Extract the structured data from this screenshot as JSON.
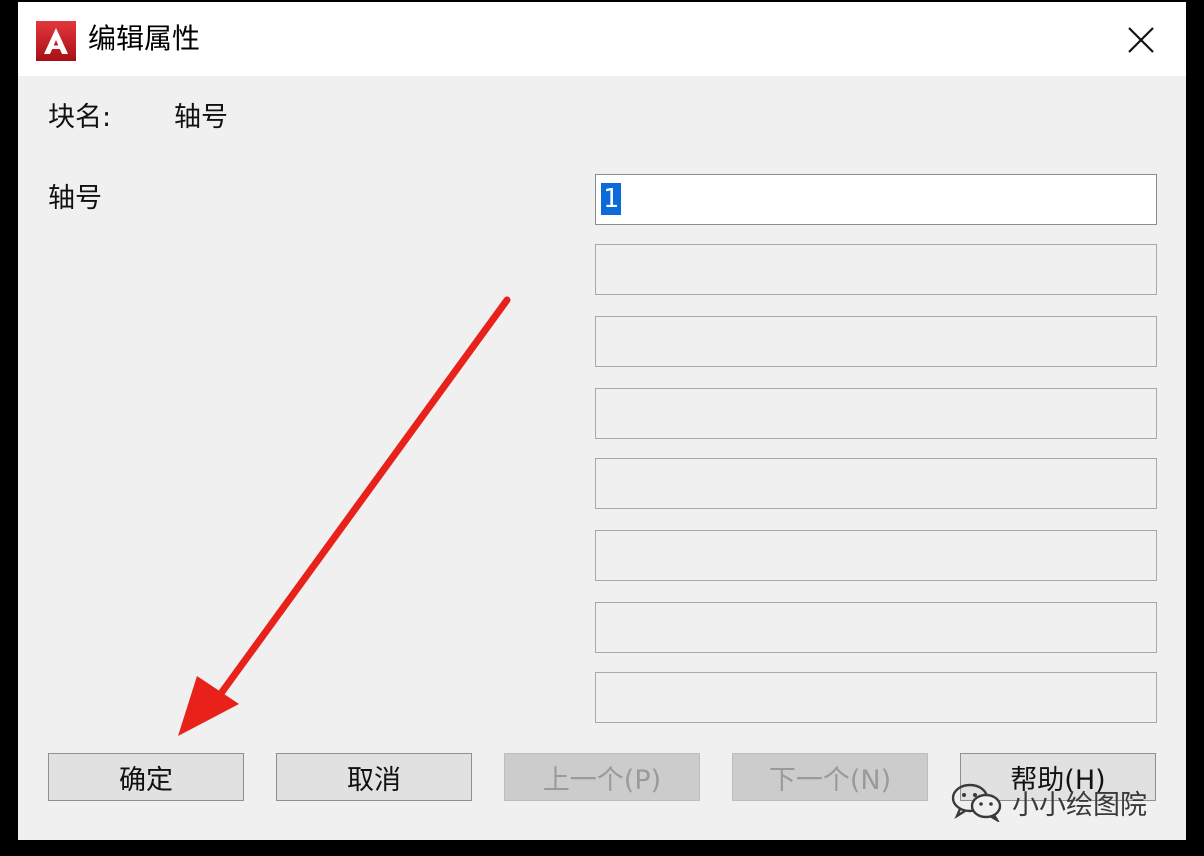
{
  "window": {
    "title": "编辑属性",
    "icon": "autocad-icon",
    "close_icon": "close-icon"
  },
  "block": {
    "label": "块名:",
    "value": "轴号"
  },
  "attributes": [
    {
      "prompt": "轴号",
      "value": "1"
    }
  ],
  "empty_fields": 7,
  "buttons": {
    "ok": "确定",
    "cancel": "取消",
    "prev": "上一个(P)",
    "next": "下一个(N)",
    "help": "帮助(H)"
  },
  "watermark": {
    "text": "小小绘图院",
    "icon": "wechat-icon"
  },
  "colors": {
    "arrow": "#e8211b",
    "selection": "#0a6bd9",
    "icon_red": "#c8161d"
  }
}
